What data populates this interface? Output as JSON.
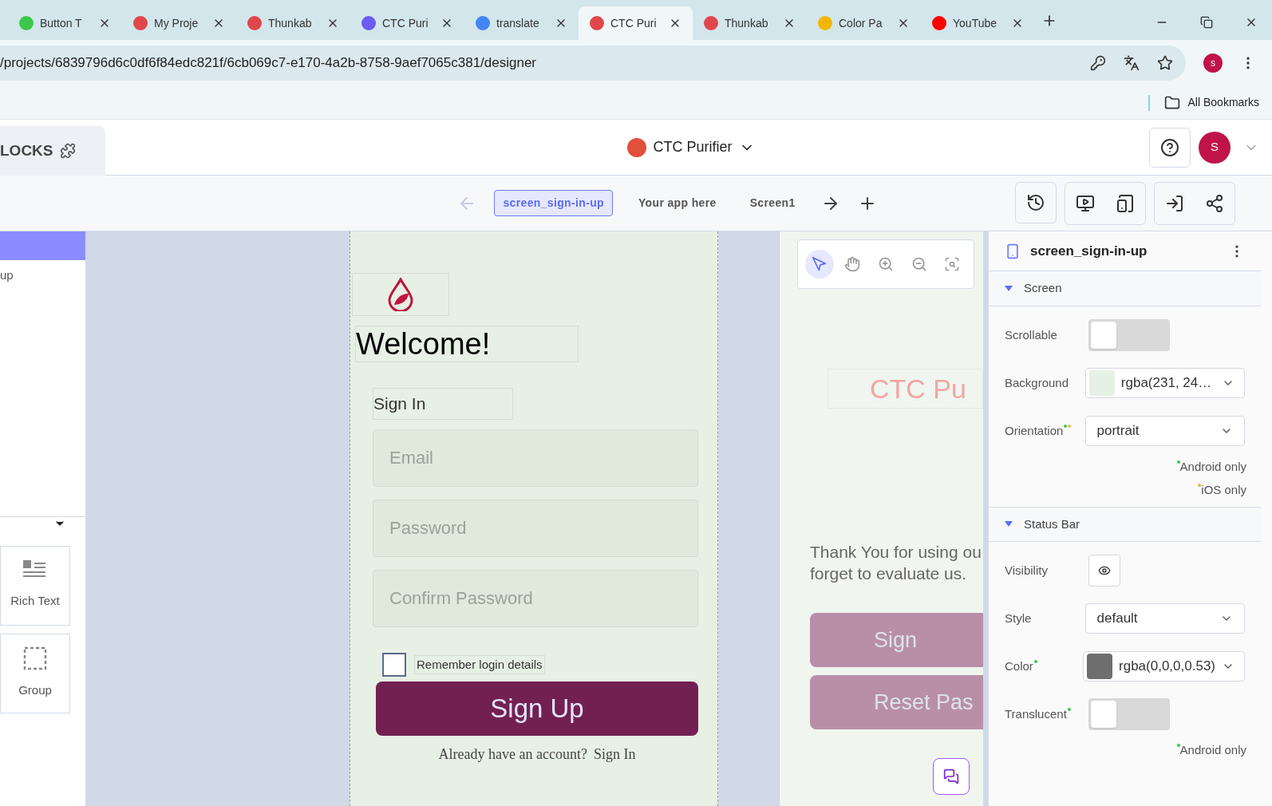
{
  "browser": {
    "tabs": [
      {
        "title": "Button T",
        "selected": false,
        "color": "#3cc84a"
      },
      {
        "title": "My Proje",
        "selected": false,
        "color": "#e0474c"
      },
      {
        "title": "Thunkab",
        "selected": false,
        "color": "#e0474c"
      },
      {
        "title": "CTC Puri",
        "selected": false,
        "color": "#6a5cf0"
      },
      {
        "title": "translate",
        "selected": false,
        "color": "#4285f4"
      },
      {
        "title": "CTC Puri",
        "selected": true,
        "color": "#e0474c"
      },
      {
        "title": "Thunkab",
        "selected": false,
        "color": "#e0474c"
      },
      {
        "title": "Color Pa",
        "selected": false,
        "color": "#f2b705"
      },
      {
        "title": "YouTube",
        "selected": false,
        "color": "#ff0000"
      }
    ],
    "url": "/projects/6839796d6c0df6f84edc821f/6cb069c7-e170-4a2b-8758-9aef7065c381/designer",
    "profile": "s",
    "bookmarks": "All Bookmarks"
  },
  "header": {
    "section": "LOCKS",
    "project": "CTC Purifier",
    "avatar": "S"
  },
  "screens": [
    {
      "label": "screen_sign-in-up",
      "selected": true
    },
    {
      "label": "Your app here",
      "selected": false
    },
    {
      "label": "Screen1",
      "selected": false
    }
  ],
  "left_panel": {
    "item": "up",
    "components": [
      {
        "kind": "rich-text",
        "label": "Rich Text"
      },
      {
        "kind": "group",
        "label": "Group"
      }
    ]
  },
  "phone": {
    "welcome": "Welcome!",
    "heading": "Sign In",
    "fields": [
      {
        "placeholder": "Email"
      },
      {
        "placeholder": "Password"
      },
      {
        "placeholder": "Confirm Password"
      }
    ],
    "remember": {
      "label": "Remember login details",
      "checked": false
    },
    "button": "Sign Up",
    "footer": "Already have an account?",
    "link": "Sign In"
  },
  "preview": {
    "title": "CTC Pu",
    "message": [
      "Thank You for using ou",
      "forget to evaluate us."
    ],
    "buttons": [
      "Sign",
      "Reset Pas"
    ]
  },
  "canvas_tools": [
    {
      "kind": "pointer",
      "selected": true
    },
    {
      "kind": "hand",
      "selected": false
    },
    {
      "kind": "zoom-in",
      "selected": false
    },
    {
      "kind": "zoom-out",
      "selected": false
    },
    {
      "kind": "fit",
      "selected": false
    }
  ],
  "properties": {
    "title": "screen_sign-in-up",
    "sections": [
      {
        "title": "Screen",
        "expanded": true,
        "rows": [
          {
            "kind": "toggle",
            "label": "Scrollable",
            "on": false,
            "markers": []
          },
          {
            "kind": "color",
            "label": "Background",
            "value": "rgba(231, 24…",
            "color": "#e7f0e4",
            "markers": []
          },
          {
            "kind": "select",
            "label": "Orientation",
            "value": "portrait",
            "markers": [
              {
                "color": "#3cc84a"
              },
              {
                "color": "#f2b24a"
              }
            ]
          }
        ],
        "notes": [
          {
            "color": "#3cc84a",
            "text": "Android only"
          },
          {
            "color": "#f2b24a",
            "text": "iOS only"
          }
        ]
      },
      {
        "title": "Status Bar",
        "expanded": true,
        "rows": [
          {
            "kind": "visibility",
            "label": "Visibility",
            "markers": []
          },
          {
            "kind": "select",
            "label": "Style",
            "value": "default",
            "markers": []
          },
          {
            "kind": "color",
            "label": "Color",
            "value": "rgba(0,0,0,0.53)",
            "color": "#6e6e6e",
            "markers": [
              {
                "color": "#3cc84a"
              }
            ]
          },
          {
            "kind": "toggle",
            "label": "Translucent",
            "on": false,
            "markers": [
              {
                "color": "#3cc84a"
              }
            ]
          }
        ],
        "notes": [
          {
            "color": "#3cc84a",
            "text": "Android only"
          }
        ]
      }
    ]
  }
}
